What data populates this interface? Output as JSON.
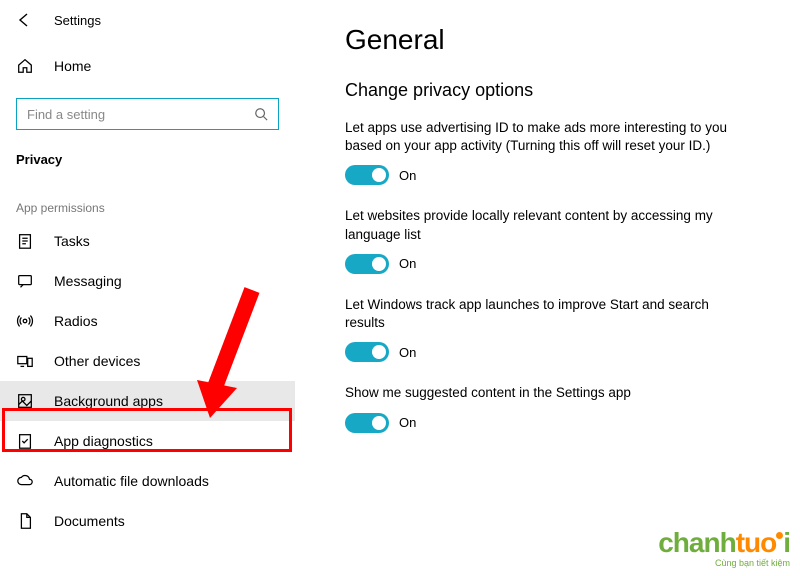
{
  "header": {
    "settings_label": "Settings"
  },
  "sidebar": {
    "home_label": "Home",
    "search_placeholder": "Find a setting",
    "privacy_label": "Privacy",
    "section_label": "App permissions",
    "items": [
      {
        "label": "Tasks"
      },
      {
        "label": "Messaging"
      },
      {
        "label": "Radios"
      },
      {
        "label": "Other devices"
      },
      {
        "label": "Background apps"
      },
      {
        "label": "App diagnostics"
      },
      {
        "label": "Automatic file downloads"
      },
      {
        "label": "Documents"
      }
    ],
    "selected_index": 4
  },
  "main": {
    "title": "General",
    "subheading": "Change privacy options",
    "options": [
      {
        "desc": "Let apps use advertising ID to make ads more interesting to you based on your app activity (Turning this off will reset your ID.)",
        "state": "On"
      },
      {
        "desc": "Let websites provide locally relevant content by accessing my language list",
        "state": "On"
      },
      {
        "desc": "Let Windows track app launches to improve Start and search results",
        "state": "On"
      },
      {
        "desc": "Show me suggested content in the Settings app",
        "state": "On"
      }
    ]
  },
  "watermark": {
    "brand_a": "chanh",
    "brand_b": "tuo",
    "brand_c": "i",
    "tagline": "Cùng bạn tiết kiệm"
  },
  "colors": {
    "accent": "#17a8c5",
    "highlight": "#ff0000"
  }
}
